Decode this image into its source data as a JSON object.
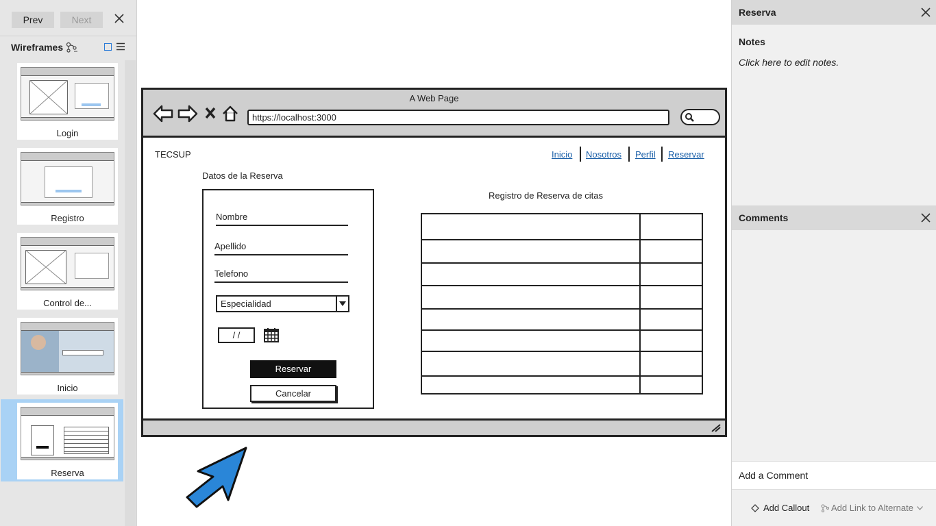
{
  "left_panel": {
    "prev_label": "Prev",
    "next_label": "Next",
    "section_title": "Wireframes",
    "thumbnails": [
      {
        "label": "Login"
      },
      {
        "label": "Registro"
      },
      {
        "label": "Control de..."
      },
      {
        "label": "Inicio"
      },
      {
        "label": "Reserva",
        "selected": true
      }
    ]
  },
  "wireframe": {
    "window_title": "A Web Page",
    "url": "https://localhost:3000",
    "brand": "TECSUP",
    "nav_links": [
      "Inicio",
      "Nosotros",
      "Perfil",
      "Reservar"
    ],
    "form_title": "Datos de la Reserva",
    "fields": [
      "Nombre",
      "Apellido",
      "Telefono"
    ],
    "select_value": "Especialidad",
    "date_value": "/ /",
    "primary_button": "Reservar",
    "secondary_button": "Cancelar",
    "table_title": "Registro de Reserva de citas",
    "table_rows": 8
  },
  "right_panel": {
    "header_title": "Reserva",
    "notes_label": "Notes",
    "notes_placeholder": "Click here to edit notes.",
    "comments_title": "Comments",
    "add_comment": "Add a Comment",
    "add_callout": "Add Callout",
    "add_link": "Add Link to Alternate"
  },
  "colors": {
    "accent": "#2b7cd8",
    "selected_thumb": "#a9d2f5",
    "link": "#1a5fa8",
    "arrow": "#2a86d8"
  }
}
